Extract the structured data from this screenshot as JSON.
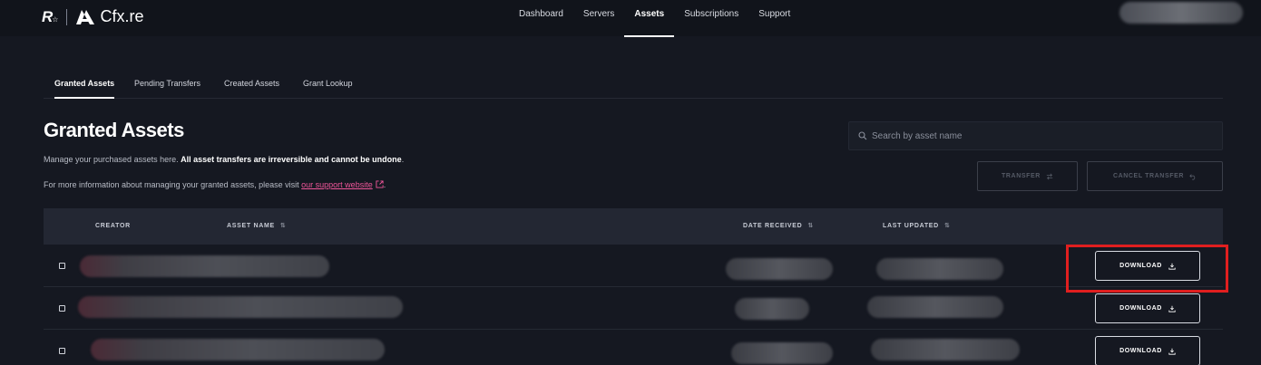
{
  "brand": {
    "rs_logo": "R",
    "rs_logo_sub": "☆",
    "name": "Cfx.re"
  },
  "nav": {
    "items": [
      {
        "label": "Dashboard",
        "active": false
      },
      {
        "label": "Servers",
        "active": false
      },
      {
        "label": "Assets",
        "active": true
      },
      {
        "label": "Subscriptions",
        "active": false
      },
      {
        "label": "Support",
        "active": false
      }
    ]
  },
  "subtabs": {
    "items": [
      {
        "label": "Granted Assets",
        "active": true
      },
      {
        "label": "Pending Transfers",
        "active": false
      },
      {
        "label": "Created Assets",
        "active": false
      },
      {
        "label": "Grant Lookup",
        "active": false
      }
    ]
  },
  "page": {
    "title": "Granted Assets",
    "desc_prefix": "Manage your purchased assets here. ",
    "desc_bold": "All asset transfers are irreversible and cannot be undone",
    "desc_suffix": ".",
    "info_prefix": "For more information about managing your granted assets, please visit ",
    "info_link": "our support website",
    "info_suffix": "."
  },
  "search": {
    "placeholder": "Search by asset name",
    "value": ""
  },
  "actions": {
    "transfer_label": "TRANSFER",
    "cancel_transfer_label": "CANCEL TRANSFER"
  },
  "table": {
    "columns": [
      "CREATOR",
      "ASSET NAME",
      "DATE RECEIVED",
      "LAST UPDATED"
    ],
    "rows": [
      {
        "download_label": "DOWNLOAD"
      },
      {
        "download_label": "DOWNLOAD"
      },
      {
        "download_label": "DOWNLOAD"
      }
    ]
  },
  "colors": {
    "accent_link": "#f0569a",
    "highlight": "#e01f1f",
    "background": "#151821"
  },
  "icons": [
    "search-icon",
    "transfer-icon",
    "undo-icon",
    "download-icon",
    "external-link-icon",
    "sort-icon"
  ]
}
